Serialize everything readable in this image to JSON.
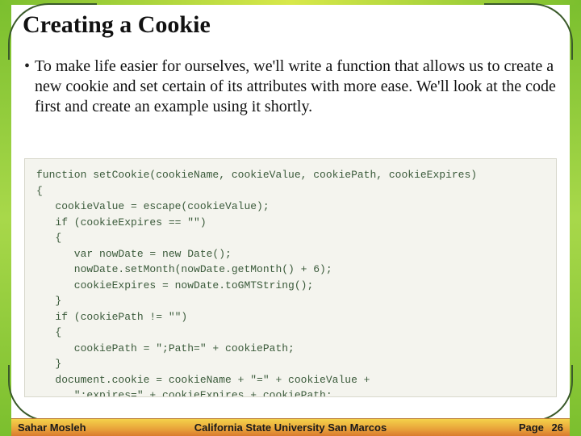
{
  "title": "Creating a Cookie",
  "bullet": "To make life easier for ourselves, we'll write a function that allows us to create a new cookie and set certain of its attributes with more ease. We'll look at the code first and create an example using it shortly.",
  "code": "function setCookie(cookieName, cookieValue, cookiePath, cookieExpires)\n{\n   cookieValue = escape(cookieValue);\n   if (cookieExpires == \"\")\n   {\n      var nowDate = new Date();\n      nowDate.setMonth(nowDate.getMonth() + 6);\n      cookieExpires = nowDate.toGMTString();\n   }\n   if (cookiePath != \"\")\n   {\n      cookiePath = \";Path=\" + cookiePath;\n   }\n   document.cookie = cookieName + \"=\" + cookieValue +\n      \";expires=\" + cookieExpires + cookiePath;\n}",
  "footer": {
    "left": "Sahar Mosleh",
    "center": "California State University San Marcos",
    "right_label": "Page",
    "right_number": "26"
  }
}
